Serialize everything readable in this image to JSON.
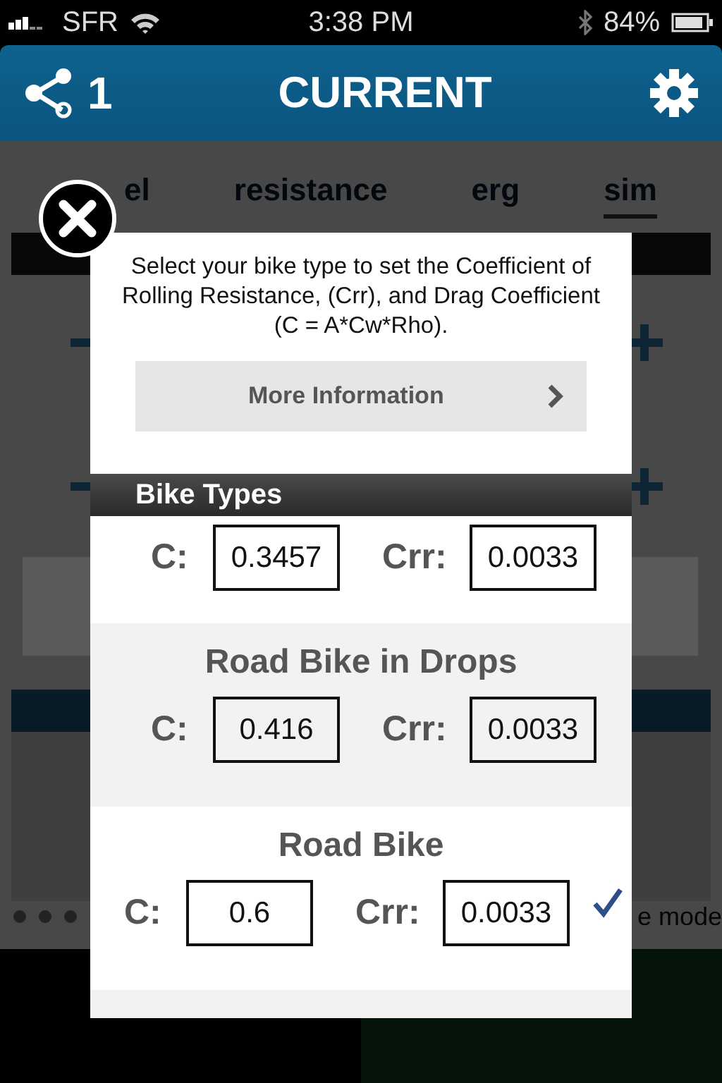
{
  "status_bar": {
    "carrier": "SFR",
    "time": "3:38 PM",
    "battery": "84%"
  },
  "header": {
    "share_count": "1",
    "title": "CURRENT"
  },
  "background": {
    "tabs": [
      {
        "label": "el",
        "selected": false
      },
      {
        "label": "resistance",
        "selected": false
      },
      {
        "label": "erg",
        "selected": false
      },
      {
        "label": "sim",
        "selected": true
      }
    ],
    "mode_text": "e mode",
    "buttons": [
      {
        "kind": "back"
      },
      {
        "kind": "start"
      }
    ]
  },
  "dialog": {
    "intro": "Select your bike type to set the Coefficient of Rolling Resistance, (Crr), and Drag Coefficient (C = A*Cw*Rho).",
    "more_button": "More Information",
    "section_title": "Bike Types",
    "bike_types": [
      {
        "c_label": "C:",
        "c_value": "0.3457",
        "crr_label": "Crr:",
        "crr_value": "0.0033",
        "selected": false
      },
      {
        "name": "Road Bike in Drops",
        "c_label": "C:",
        "c_value": "0.416",
        "crr_label": "Crr:",
        "crr_value": "0.0033",
        "selected": false
      },
      {
        "name": "Road Bike",
        "c_label": "C:",
        "c_value": "0.6",
        "crr_label": "Crr:",
        "crr_value": "0.0033",
        "selected": true
      }
    ]
  }
}
